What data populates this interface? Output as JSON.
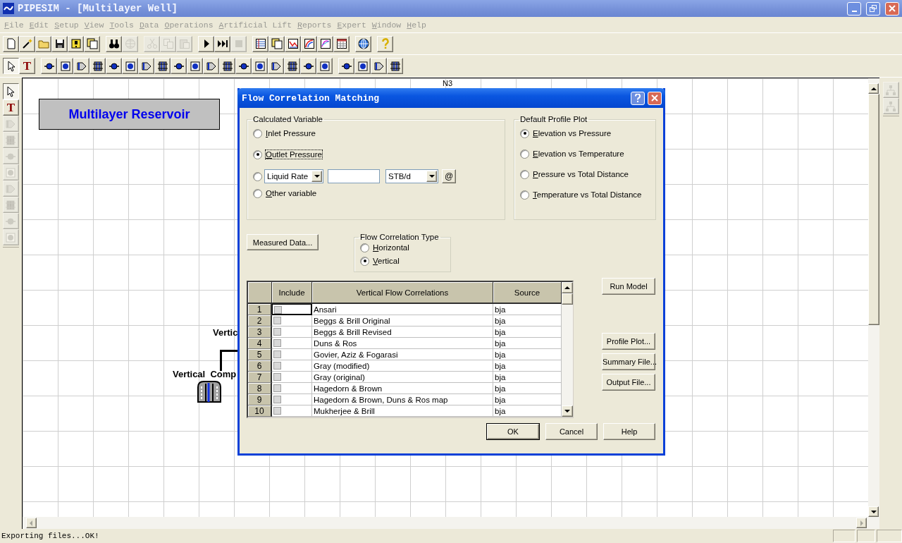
{
  "window": {
    "title": "PIPESIM - [Multilayer Well]"
  },
  "menu": [
    {
      "label": "File",
      "disabled": true
    },
    {
      "label": "Edit",
      "disabled": true
    },
    {
      "label": "Setup",
      "disabled": true
    },
    {
      "label": "View",
      "disabled": true
    },
    {
      "label": "Tools",
      "disabled": true
    },
    {
      "label": "Data",
      "disabled": true
    },
    {
      "label": "Operations",
      "disabled": true
    },
    {
      "label": "Artificial Lift",
      "disabled": true
    },
    {
      "label": "Reports",
      "disabled": true
    },
    {
      "label": "Expert",
      "disabled": true
    },
    {
      "label": "Window",
      "disabled": true
    },
    {
      "label": "Help",
      "disabled": true
    }
  ],
  "toolbar_1": [
    [
      {
        "kind": "page",
        "disabled": false
      },
      {
        "kind": "wand",
        "disabled": false
      },
      {
        "kind": "folder",
        "disabled": false
      },
      {
        "kind": "disk",
        "disabled": false
      },
      {
        "kind": "note",
        "disabled": false
      },
      {
        "kind": "pages",
        "disabled": false
      }
    ],
    [
      {
        "kind": "binoculars",
        "disabled": false
      },
      {
        "kind": "gridglobe",
        "disabled": true
      }
    ],
    [
      {
        "kind": "scissors",
        "disabled": true
      },
      {
        "kind": "copy",
        "disabled": true
      },
      {
        "kind": "paste",
        "disabled": true
      }
    ],
    [
      {
        "kind": "play",
        "disabled": false
      },
      {
        "kind": "fastforward",
        "disabled": false
      },
      {
        "kind": "stop",
        "disabled": true
      }
    ],
    [
      {
        "kind": "table",
        "disabled": false
      },
      {
        "kind": "pages",
        "disabled": false
      },
      {
        "kind": "linechart",
        "disabled": false
      },
      {
        "kind": "contour",
        "disabled": false
      },
      {
        "kind": "curve",
        "disabled": false
      },
      {
        "kind": "calendar",
        "disabled": false
      }
    ],
    [
      {
        "kind": "globe",
        "disabled": false
      }
    ],
    [
      {
        "kind": "help",
        "disabled": false
      }
    ]
  ],
  "toolbar_2": [
    [
      {
        "kind": "pointer",
        "selected": true
      },
      {
        "kind": "text",
        "label": "T",
        "selected": false
      }
    ],
    [
      {
        "kind": "device"
      },
      {
        "kind": "device"
      },
      {
        "kind": "device"
      },
      {
        "kind": "device"
      },
      {
        "kind": "device"
      },
      {
        "kind": "device"
      },
      {
        "kind": "device"
      },
      {
        "kind": "device"
      },
      {
        "kind": "device"
      },
      {
        "kind": "device"
      },
      {
        "kind": "device"
      },
      {
        "kind": "device"
      },
      {
        "kind": "device"
      },
      {
        "kind": "device"
      },
      {
        "kind": "device"
      },
      {
        "kind": "device"
      },
      {
        "kind": "device"
      },
      {
        "kind": "device"
      }
    ],
    [
      {
        "kind": "device"
      },
      {
        "kind": "device"
      },
      {
        "kind": "device"
      },
      {
        "kind": "device"
      }
    ]
  ],
  "left_palette": [
    {
      "kind": "pointer",
      "selected": true,
      "disabled": false
    },
    {
      "kind": "text",
      "label": "T",
      "selected": false,
      "disabled": false
    },
    {
      "kind": "device",
      "selected": false,
      "disabled": true
    },
    {
      "kind": "device",
      "selected": false,
      "disabled": true
    },
    {
      "kind": "device",
      "selected": false,
      "disabled": true
    },
    {
      "kind": "device",
      "selected": false,
      "disabled": true
    },
    {
      "kind": "device",
      "selected": false,
      "disabled": true
    },
    {
      "kind": "device",
      "selected": false,
      "disabled": true
    },
    {
      "kind": "device",
      "selected": false,
      "disabled": true
    },
    {
      "kind": "device",
      "selected": false,
      "disabled": true
    }
  ],
  "right_palette": [
    {
      "kind": "tree",
      "disabled": true
    },
    {
      "kind": "tree",
      "disabled": true
    }
  ],
  "canvas": {
    "items": [
      {
        "kind": "banner",
        "text": "Multilayer Reservoir"
      },
      {
        "kind": "label",
        "text": "N3"
      },
      {
        "kind": "bold",
        "text": "Vertic"
      },
      {
        "kind": "bold",
        "text": "Vertical  Comp"
      },
      {
        "kind": "connector"
      },
      {
        "kind": "well"
      }
    ]
  },
  "dialog": {
    "title": "Flow Correlation Matching",
    "calculated_variable": {
      "label": "Calculated Variable",
      "options": [
        {
          "kind": "radio",
          "label": "Inlet Pressure",
          "selected": false,
          "focused": false
        },
        {
          "kind": "radio",
          "label": "Outlet Pressure",
          "selected": true,
          "focused": true
        },
        {
          "kind": "rate",
          "selected": false,
          "combo": "Liquid Rate",
          "unit": "STB/d",
          "button": "@"
        },
        {
          "kind": "radio",
          "label": "Other variable",
          "selected": false,
          "focused": false
        }
      ]
    },
    "default_profile_plot": {
      "label": "Default Profile Plot",
      "options": [
        {
          "label": "Elevation vs Pressure",
          "selected": true
        },
        {
          "label": "Elevation vs Temperature",
          "selected": false
        },
        {
          "label": "Pressure vs Total Distance",
          "selected": false
        },
        {
          "label": "Temperature vs Total Distance",
          "selected": false
        }
      ]
    },
    "measured_data_button": "Measured Data...",
    "flow_correlation_type": {
      "label": "Flow Correlation Type",
      "options": [
        {
          "label": "Horizontal",
          "selected": false
        },
        {
          "label": "Vertical",
          "selected": true
        }
      ]
    },
    "table": {
      "columns": [
        "Include",
        "Vertical Flow Correlations",
        "Source"
      ],
      "rows": [
        {
          "number": "1",
          "include": false,
          "name": "Ansari",
          "source": "bja"
        },
        {
          "number": "2",
          "include": false,
          "name": "Beggs & Brill Original",
          "source": "bja"
        },
        {
          "number": "3",
          "include": false,
          "name": "Beggs & Brill Revised",
          "source": "bja"
        },
        {
          "number": "4",
          "include": false,
          "name": "Duns & Ros",
          "source": "bja"
        },
        {
          "number": "5",
          "include": false,
          "name": "Govier, Aziz & Fogarasi",
          "source": "bja"
        },
        {
          "number": "6",
          "include": false,
          "name": "Gray (modified)",
          "source": "bja"
        },
        {
          "number": "7",
          "include": false,
          "name": "Gray (original)",
          "source": "bja"
        },
        {
          "number": "8",
          "include": false,
          "name": "Hagedorn & Brown",
          "source": "bja"
        },
        {
          "number": "9",
          "include": false,
          "name": "Hagedorn & Brown, Duns & Ros map",
          "source": "bja"
        },
        {
          "number": "10",
          "include": false,
          "name": "Mukherjee & Brill",
          "source": "bja"
        }
      ]
    },
    "side_buttons": [
      {
        "kind": "top",
        "label": "Run Model"
      },
      {
        "kind": "gap",
        "label": "Profile Plot..."
      },
      {
        "kind": "plain",
        "label": "Summary File..."
      },
      {
        "kind": "plain",
        "label": "Output File..."
      }
    ],
    "bottom_buttons": [
      {
        "label": "OK",
        "default": true
      },
      {
        "label": "Cancel",
        "default": false
      },
      {
        "label": "Help",
        "default": false
      }
    ]
  },
  "status_bar": {
    "text": "Exporting files...OK!"
  }
}
